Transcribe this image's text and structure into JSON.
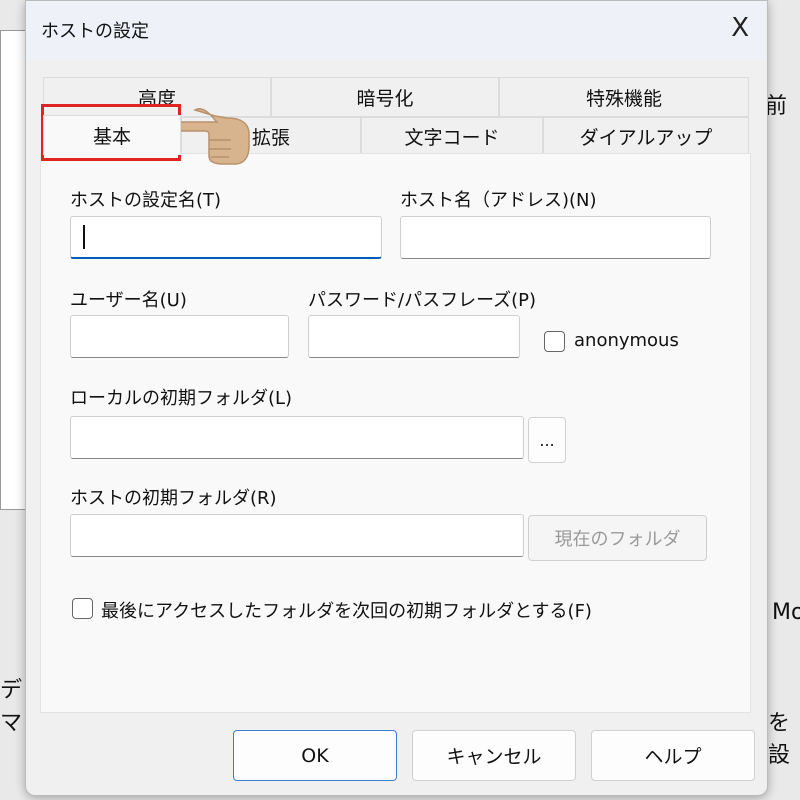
{
  "dialog": {
    "title": "ホストの設定",
    "close_label": "X"
  },
  "tabs": {
    "row1": [
      "高度",
      "暗号化",
      "特殊機能"
    ],
    "row2": [
      "基本",
      "拡張",
      "文字コード",
      "ダイアルアップ"
    ],
    "active": "基本"
  },
  "fields": {
    "host_setting_name": {
      "label": "ホストの設定名(T)",
      "value": ""
    },
    "host_name": {
      "label": "ホスト名（アドレス)(N)",
      "value": ""
    },
    "user_name": {
      "label": "ユーザー名(U)",
      "value": ""
    },
    "password": {
      "label": "パスワード/パスフレーズ(P)",
      "value": ""
    },
    "anonymous": {
      "label": "anonymous",
      "checked": false
    },
    "local_folder": {
      "label": "ローカルの初期フォルダ(L)",
      "value": "",
      "browse": "..."
    },
    "host_folder": {
      "label": "ホストの初期フォルダ(R)",
      "value": "",
      "current_folder_button": "現在のフォルダ"
    },
    "last_folder": {
      "label": "最後にアクセスしたフォルダを次回の初期フォルダとする(F)",
      "checked": false
    }
  },
  "buttons": {
    "ok": "OK",
    "cancel": "キャンセル",
    "help": "ヘルプ"
  },
  "annotation": {
    "highlight_color": "#e02424",
    "pointer": "pointing-hand"
  },
  "background": {
    "fragments": [
      "前",
      "Mo",
      "デ",
      "マ",
      "を設"
    ]
  }
}
